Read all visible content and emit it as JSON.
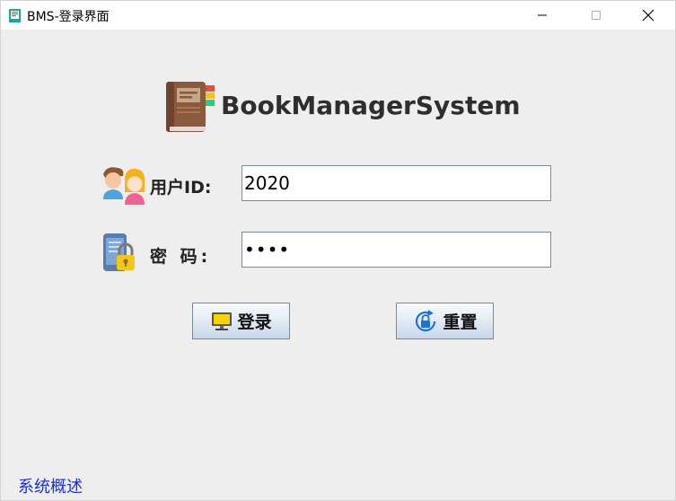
{
  "window": {
    "title": "BMS-登录界面",
    "controls": {
      "minimize": "—",
      "maximize": "☐",
      "close": "✕"
    }
  },
  "header": {
    "app_name": "BookManagerSystem"
  },
  "form": {
    "user_id": {
      "label": "用户ID:",
      "value": "2020"
    },
    "password": {
      "label": "密  码:",
      "value": "••••"
    }
  },
  "buttons": {
    "login_label": "登录",
    "reset_label": "重置"
  },
  "footer": {
    "link_label": "系统概述"
  },
  "icons": {
    "app": "book-icon",
    "logo": "book-logo-icon",
    "user": "users-icon",
    "password": "phone-lock-icon",
    "login": "monitor-icon",
    "reset": "refresh-lock-icon"
  },
  "colors": {
    "window_bg": "#eeeeee",
    "link": "#1a2fd6",
    "button_gradient_top": "#f7fafd",
    "button_gradient_bottom": "#c8d7e8"
  }
}
